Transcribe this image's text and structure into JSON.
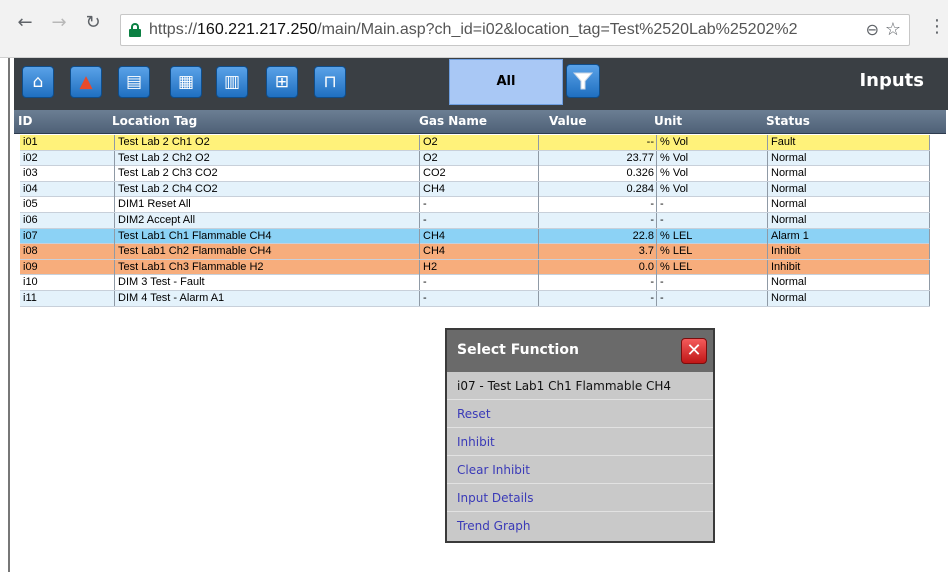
{
  "browser": {
    "back_icon": "back-arrow-icon",
    "forward_icon": "forward-arrow-icon",
    "reload_icon": "reload-icon",
    "url_scheme": "https://",
    "url_host": "160.221.217.250",
    "url_path": "/main/Main.asp?ch_id=i02&location_tag=Test%2520Lab%25202%2",
    "zoom_icon": "zoom-icon",
    "star_icon": "bookmark-star-icon",
    "menu_icon": "kebab-menu-icon"
  },
  "toolbar": {
    "buttons": [
      {
        "name": "home-icon",
        "glyph": "⌂"
      },
      {
        "name": "alarm-bell-icon",
        "glyph": "🔔"
      },
      {
        "name": "document-icon",
        "glyph": "▤"
      },
      {
        "name": "document-export-icon",
        "glyph": "▦"
      },
      {
        "name": "document-settings-icon",
        "glyph": "▥"
      },
      {
        "name": "add-panel-icon",
        "glyph": "⊞"
      },
      {
        "name": "unlock-icon",
        "glyph": "🔓"
      }
    ],
    "filter_label": "All",
    "filter_icon": "funnel-icon",
    "page_title": "Inputs"
  },
  "table": {
    "headers": {
      "id": "ID",
      "location": "Location Tag",
      "gas": "Gas Name",
      "value": "Value",
      "unit": "Unit",
      "status": "Status"
    },
    "rows": [
      {
        "id": "i01",
        "location": "Test Lab 2 Ch1 O2",
        "gas": "O2",
        "value": "--",
        "unit": "% Vol",
        "status": "Fault",
        "state": "fault"
      },
      {
        "id": "i02",
        "location": "Test Lab 2 Ch2 O2",
        "gas": "O2",
        "value": "23.77",
        "unit": "% Vol",
        "status": "Normal",
        "state": "normal"
      },
      {
        "id": "i03",
        "location": "Test Lab 2 Ch3 CO2",
        "gas": "CO2",
        "value": "0.326",
        "unit": "% Vol",
        "status": "Normal",
        "state": "normal"
      },
      {
        "id": "i04",
        "location": "Test Lab 2 Ch4 CO2",
        "gas": "CH4",
        "value": "0.284",
        "unit": "% Vol",
        "status": "Normal",
        "state": "normal"
      },
      {
        "id": "i05",
        "location": "DIM1 Reset All",
        "gas": "-",
        "value": "-",
        "unit": "-",
        "status": "Normal",
        "state": "normal"
      },
      {
        "id": "i06",
        "location": "DIM2 Accept All",
        "gas": "-",
        "value": "-",
        "unit": "-",
        "status": "Normal",
        "state": "normal"
      },
      {
        "id": "i07",
        "location": "Test Lab1 Ch1 Flammable CH4",
        "gas": "CH4",
        "value": "22.8",
        "unit": "% LEL",
        "status": "Alarm 1",
        "state": "alarm"
      },
      {
        "id": "i08",
        "location": "Test Lab1 Ch2 Flammable CH4",
        "gas": "CH4",
        "value": "3.7",
        "unit": "% LEL",
        "status": "Inhibit",
        "state": "inhibit"
      },
      {
        "id": "i09",
        "location": "Test Lab1 Ch3 Flammable H2",
        "gas": "H2",
        "value": "0.0",
        "unit": "% LEL",
        "status": "Inhibit",
        "state": "inhibit"
      },
      {
        "id": "i10",
        "location": "DIM 3 Test - Fault",
        "gas": "-",
        "value": "-",
        "unit": "-",
        "status": "Normal",
        "state": "normal"
      },
      {
        "id": "i11",
        "location": "DIM 4 Test - Alarm A1",
        "gas": "-",
        "value": "-",
        "unit": "-",
        "status": "Normal",
        "state": "normal"
      }
    ]
  },
  "dialog": {
    "title": "Select Function",
    "close_icon": "close-icon",
    "subject": "i07 - Test Lab1 Ch1 Flammable CH4",
    "actions": [
      "Reset",
      "Inhibit",
      "Clear Inhibit",
      "Input Details",
      "Trend Graph"
    ]
  },
  "colors": {
    "fault": "#fff27a",
    "normal": "#e4f2fb",
    "alarm": "#8cd2f5",
    "inhibit": "#f7ad7c",
    "toolbar": "#3a3f44",
    "filter_selected": "#a9c8f5"
  }
}
